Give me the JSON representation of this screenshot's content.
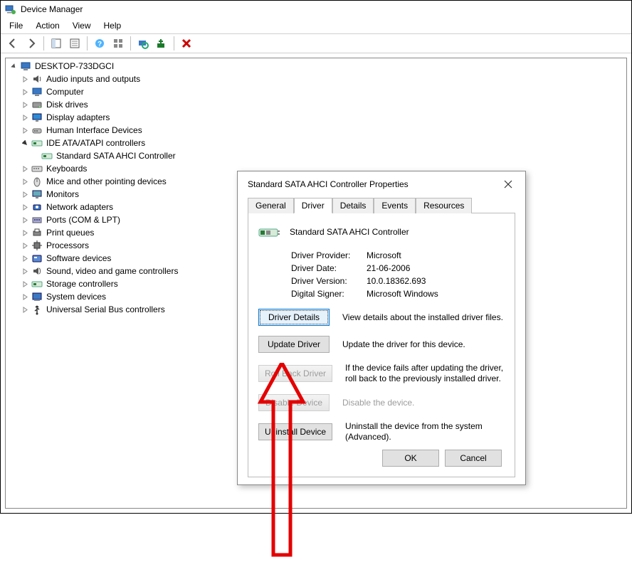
{
  "window": {
    "title": "Device Manager"
  },
  "menu": {
    "file": "File",
    "action": "Action",
    "view": "View",
    "help": "Help"
  },
  "tree": {
    "root": "DESKTOP-733DGCI",
    "items": [
      "Audio inputs and outputs",
      "Computer",
      "Disk drives",
      "Display adapters",
      "Human Interface Devices",
      "IDE ATA/ATAPI controllers",
      "Keyboards",
      "Mice and other pointing devices",
      "Monitors",
      "Network adapters",
      "Ports (COM & LPT)",
      "Print queues",
      "Processors",
      "Software devices",
      "Sound, video and game controllers",
      "Storage controllers",
      "System devices",
      "Universal Serial Bus controllers"
    ],
    "ide_child": "Standard SATA AHCI Controller"
  },
  "dialog": {
    "title": "Standard SATA AHCI Controller Properties",
    "tabs": {
      "general": "General",
      "driver": "Driver",
      "details": "Details",
      "events": "Events",
      "resources": "Resources"
    },
    "device_name": "Standard SATA AHCI Controller",
    "info": {
      "provider_k": "Driver Provider:",
      "provider_v": "Microsoft",
      "date_k": "Driver Date:",
      "date_v": "21-06-2006",
      "version_k": "Driver Version:",
      "version_v": "10.0.18362.693",
      "signer_k": "Digital Signer:",
      "signer_v": "Microsoft Windows"
    },
    "buttons": {
      "details": "Driver Details",
      "update": "Update Driver",
      "rollback": "Roll Back Driver",
      "disable": "Disable Device",
      "uninstall": "Uninstall Device",
      "ok": "OK",
      "cancel": "Cancel"
    },
    "descs": {
      "details": "View details about the installed driver files.",
      "update": "Update the driver for this device.",
      "rollback": "If the device fails after updating the driver, roll back to the previously installed driver.",
      "disable": "Disable the device.",
      "uninstall": "Uninstall the device from the system (Advanced)."
    }
  }
}
